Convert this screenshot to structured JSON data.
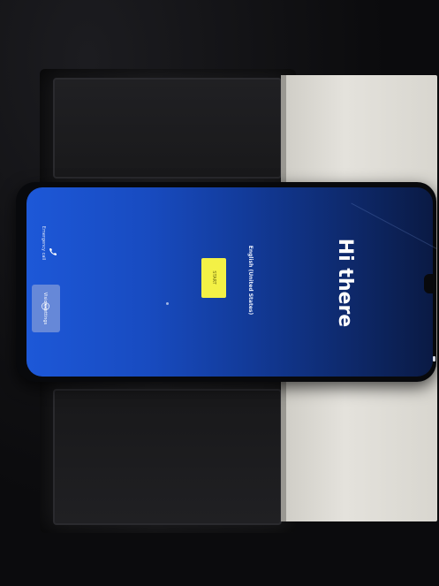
{
  "screen": {
    "greeting": "Hi there",
    "language": "English (United States)",
    "start_label": "START",
    "emergency_call": "Emergency call",
    "vision_settings": "Vision settings",
    "phone_icon": "phone-icon",
    "accessibility_icon": "accessibility-icon"
  },
  "colors": {
    "screen_gradient_start": "#1d58d8",
    "screen_gradient_end": "#0a1a44",
    "start_button": "#f3f146",
    "vision_button": "#6f8ed8",
    "box_white": "#e4e2dc",
    "box_black": "#1f1f22"
  }
}
